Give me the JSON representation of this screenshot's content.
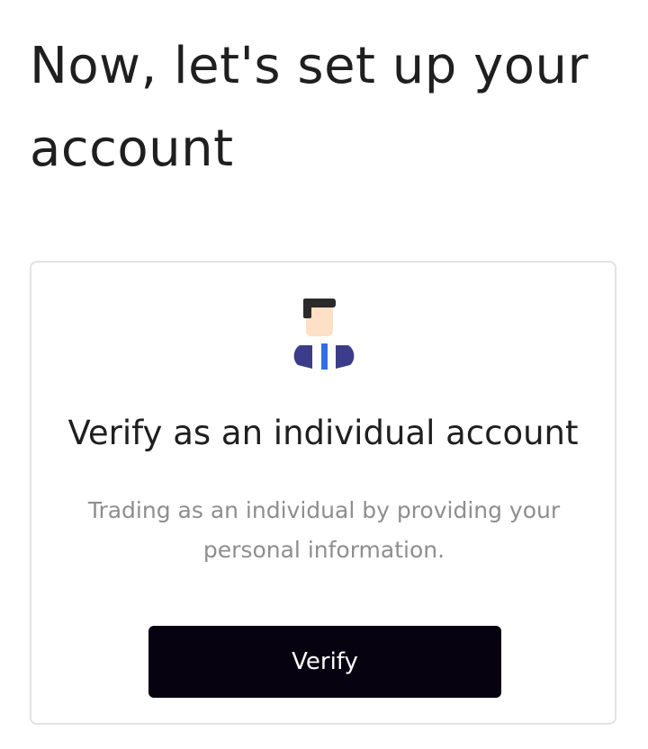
{
  "header": {
    "title": "Now, let's set up your account"
  },
  "card": {
    "icon": "individual-person-icon",
    "title": "Verify as an individual account",
    "description": "Trading as an individual by providing your personal information.",
    "button_label": "Verify"
  },
  "colors": {
    "button_background": "#07020f",
    "button_text": "#ffffff",
    "title_text": "#1f1f1f",
    "description_text": "#8e8e8e",
    "card_border": "#e3e3e3",
    "tie": "#2f6fe4",
    "suit": "#3b3d8a",
    "skin": "#fde0c5",
    "hair": "#2b2b2b"
  }
}
